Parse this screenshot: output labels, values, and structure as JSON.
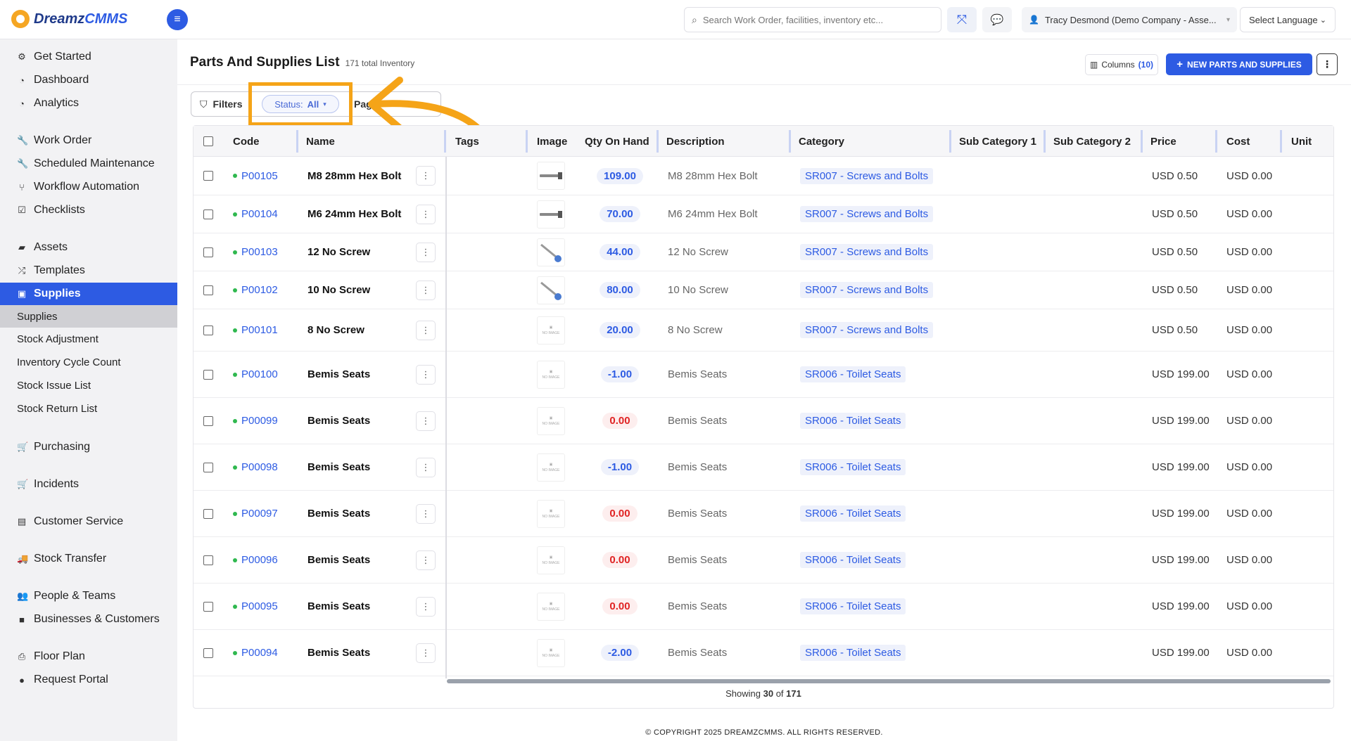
{
  "app": {
    "logo_text_a": "Dreamz",
    "logo_text_b": "CMMS"
  },
  "topbar": {
    "search_placeholder": "Search Work Order, facilities, inventory etc...",
    "user_name": "Tracy Desmond (Demo Company - Asse...",
    "language": "Select Language"
  },
  "sidebar": {
    "items": [
      {
        "label": "Get Started",
        "icon": "gears-icon"
      },
      {
        "label": "Dashboard",
        "icon": "gauge-icon"
      },
      {
        "label": "Analytics",
        "icon": "gauge-icon"
      },
      {
        "label": "Work Order",
        "icon": "wrench-icon"
      },
      {
        "label": "Scheduled Maintenance",
        "icon": "wrench-icon"
      },
      {
        "label": "Workflow Automation",
        "icon": "workflow-icon"
      },
      {
        "label": "Checklists",
        "icon": "checkbox-icon"
      },
      {
        "label": "Assets",
        "icon": "box-icon"
      },
      {
        "label": "Templates",
        "icon": "shuffle-icon"
      },
      {
        "label": "Supplies",
        "icon": "briefcase-icon"
      },
      {
        "label": "Purchasing",
        "icon": "cart-icon"
      },
      {
        "label": "Incidents",
        "icon": "cart-icon"
      },
      {
        "label": "Customer Service",
        "icon": "document-icon"
      },
      {
        "label": "Stock Transfer",
        "icon": "truck-icon"
      },
      {
        "label": "People & Teams",
        "icon": "people-icon"
      },
      {
        "label": "Businesses & Customers",
        "icon": "camera-icon"
      },
      {
        "label": "Floor Plan",
        "icon": "printer-icon"
      },
      {
        "label": "Request Portal",
        "icon": "chat-icon"
      }
    ],
    "sub_items": [
      {
        "label": "Supplies"
      },
      {
        "label": "Stock Adjustment"
      },
      {
        "label": "Inventory Cycle Count"
      },
      {
        "label": "Stock Issue List"
      },
      {
        "label": "Stock Return List"
      }
    ]
  },
  "main": {
    "title": "Parts And Supplies List",
    "total": "171 total Inventory",
    "columns_label": "Columns",
    "columns_count": "(10)",
    "new_button": "NEW PARTS AND SUPPLIES",
    "filters_label": "Filters",
    "status_label": "Status:",
    "status_value": "All",
    "page_partial": "Pag"
  },
  "table": {
    "headers": {
      "code": "Code",
      "name": "Name",
      "tags": "Tags",
      "image": "Image",
      "qty": "Qty On Hand",
      "description": "Description",
      "category": "Category",
      "sub1": "Sub Category 1",
      "sub2": "Sub Category 2",
      "price": "Price",
      "cost": "Cost",
      "unit": "Unit"
    },
    "rows": [
      {
        "code": "P00105",
        "name": "M8 28mm Hex Bolt",
        "qty": "109.00",
        "description": "M8 28mm Hex Bolt",
        "category": "SR007 - Screws and Bolts",
        "price": "USD 0.50",
        "cost": "USD 0.00"
      },
      {
        "code": "P00104",
        "name": "M6 24mm Hex Bolt",
        "qty": "70.00",
        "description": "M6 24mm Hex Bolt",
        "category": "SR007 - Screws and Bolts",
        "price": "USD 0.50",
        "cost": "USD 0.00"
      },
      {
        "code": "P00103",
        "name": "12 No Screw",
        "qty": "44.00",
        "description": "12 No Screw",
        "category": "SR007 - Screws and Bolts",
        "price": "USD 0.50",
        "cost": "USD 0.00"
      },
      {
        "code": "P00102",
        "name": "10 No Screw",
        "qty": "80.00",
        "description": "10 No Screw",
        "category": "SR007 - Screws and Bolts",
        "price": "USD 0.50",
        "cost": "USD 0.00"
      },
      {
        "code": "P00101",
        "name": "8 No Screw",
        "qty": "20.00",
        "description": "8 No Screw",
        "category": "SR007 - Screws and Bolts",
        "price": "USD 0.50",
        "cost": "USD 0.00"
      },
      {
        "code": "P00100",
        "name": "Bemis Seats",
        "qty": "-1.00",
        "description": "Bemis Seats",
        "category": "SR006 - Toilet Seats",
        "price": "USD 199.00",
        "cost": "USD 0.00"
      },
      {
        "code": "P00099",
        "name": "Bemis Seats",
        "qty": "0.00",
        "description": "Bemis Seats",
        "category": "SR006 - Toilet Seats",
        "price": "USD 199.00",
        "cost": "USD 0.00"
      },
      {
        "code": "P00098",
        "name": "Bemis Seats",
        "qty": "-1.00",
        "description": "Bemis Seats",
        "category": "SR006 - Toilet Seats",
        "price": "USD 199.00",
        "cost": "USD 0.00"
      },
      {
        "code": "P00097",
        "name": "Bemis Seats",
        "qty": "0.00",
        "description": "Bemis Seats",
        "category": "SR006 - Toilet Seats",
        "price": "USD 199.00",
        "cost": "USD 0.00"
      },
      {
        "code": "P00096",
        "name": "Bemis Seats",
        "qty": "0.00",
        "description": "Bemis Seats",
        "category": "SR006 - Toilet Seats",
        "price": "USD 199.00",
        "cost": "USD 0.00"
      },
      {
        "code": "P00095",
        "name": "Bemis Seats",
        "qty": "0.00",
        "description": "Bemis Seats",
        "category": "SR006 - Toilet Seats",
        "price": "USD 199.00",
        "cost": "USD 0.00"
      },
      {
        "code": "P00094",
        "name": "Bemis Seats",
        "qty": "-2.00",
        "description": "Bemis Seats",
        "category": "SR006 - Toilet Seats",
        "price": "USD 199.00",
        "cost": "USD 0.00"
      }
    ],
    "footer_prefix": "Showing",
    "footer_shown": "30",
    "footer_of": "of",
    "footer_total": "171"
  },
  "copyright": "© COPYRIGHT 2025 DREAMZCMMS. ALL RIGHTS RESERVED.",
  "colors": {
    "primary": "#2d5be3",
    "highlight": "#f5a418",
    "status_green": "#2fb84f",
    "negative_red": "#e02424"
  }
}
